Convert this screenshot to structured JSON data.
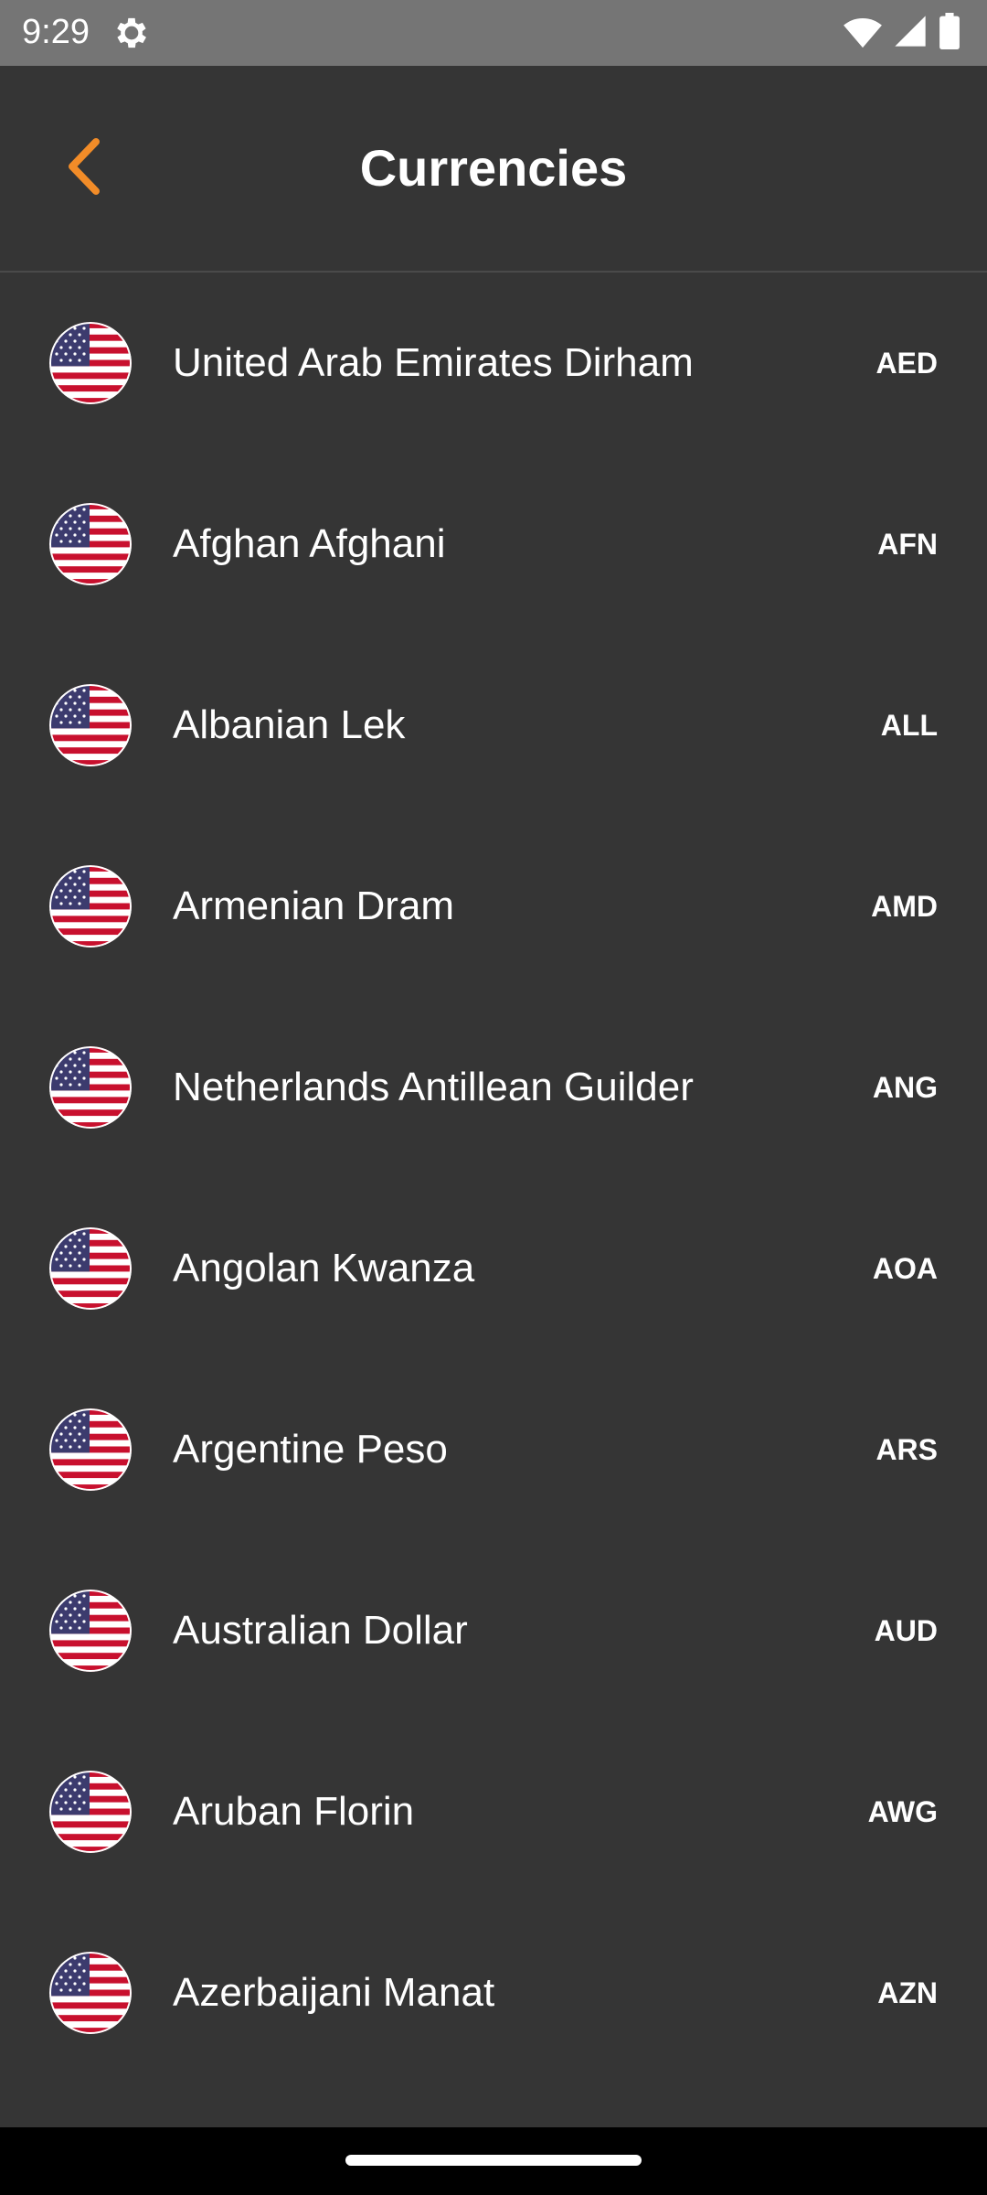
{
  "status_bar": {
    "time": "9:29",
    "icons": [
      "settings-gear-icon",
      "wifi-icon",
      "cellular-signal-icon",
      "battery-icon"
    ]
  },
  "app_bar": {
    "title": "Currencies",
    "back_icon": "chevron-left-icon",
    "accent_color": "#F28C28"
  },
  "currencies": [
    {
      "name": "United Arab Emirates Dirham",
      "code": "AED",
      "flag_icon": "us-flag-icon"
    },
    {
      "name": "Afghan Afghani",
      "code": "AFN",
      "flag_icon": "us-flag-icon"
    },
    {
      "name": "Albanian Lek",
      "code": "ALL",
      "flag_icon": "us-flag-icon"
    },
    {
      "name": "Armenian Dram",
      "code": "AMD",
      "flag_icon": "us-flag-icon"
    },
    {
      "name": "Netherlands Antillean Guilder",
      "code": "ANG",
      "flag_icon": "us-flag-icon"
    },
    {
      "name": "Angolan Kwanza",
      "code": "AOA",
      "flag_icon": "us-flag-icon"
    },
    {
      "name": "Argentine Peso",
      "code": "ARS",
      "flag_icon": "us-flag-icon"
    },
    {
      "name": "Australian Dollar",
      "code": "AUD",
      "flag_icon": "us-flag-icon"
    },
    {
      "name": "Aruban Florin",
      "code": "AWG",
      "flag_icon": "us-flag-icon"
    },
    {
      "name": "Azerbaijani Manat",
      "code": "AZN",
      "flag_icon": "us-flag-icon"
    }
  ],
  "colors": {
    "background": "#353535",
    "status_bar": "#757575",
    "text": "#FFFFFF",
    "nav_bar": "#000000"
  }
}
